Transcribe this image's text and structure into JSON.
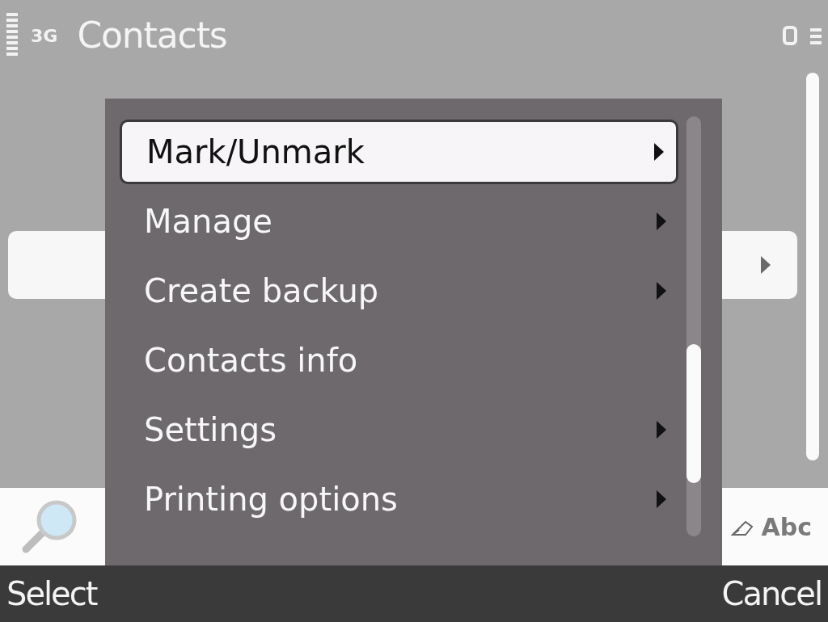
{
  "status_bar": {
    "network": "3G",
    "title": "Contacts"
  },
  "contact_rows": [
    {
      "selected": false
    },
    {
      "selected": false
    },
    {
      "selected": true
    }
  ],
  "menu": {
    "items": [
      {
        "label": "Mark/Unmark",
        "submenu": true,
        "selected": true
      },
      {
        "label": "Manage",
        "submenu": true,
        "selected": false
      },
      {
        "label": "Create backup",
        "submenu": true,
        "selected": false
      },
      {
        "label": "Contacts info",
        "submenu": false,
        "selected": false
      },
      {
        "label": "Settings",
        "submenu": true,
        "selected": false
      },
      {
        "label": "Printing options",
        "submenu": true,
        "selected": false
      }
    ]
  },
  "search_bar": {
    "input_mode": "Abc"
  },
  "softkeys": {
    "left": "Select",
    "right": "Cancel"
  }
}
